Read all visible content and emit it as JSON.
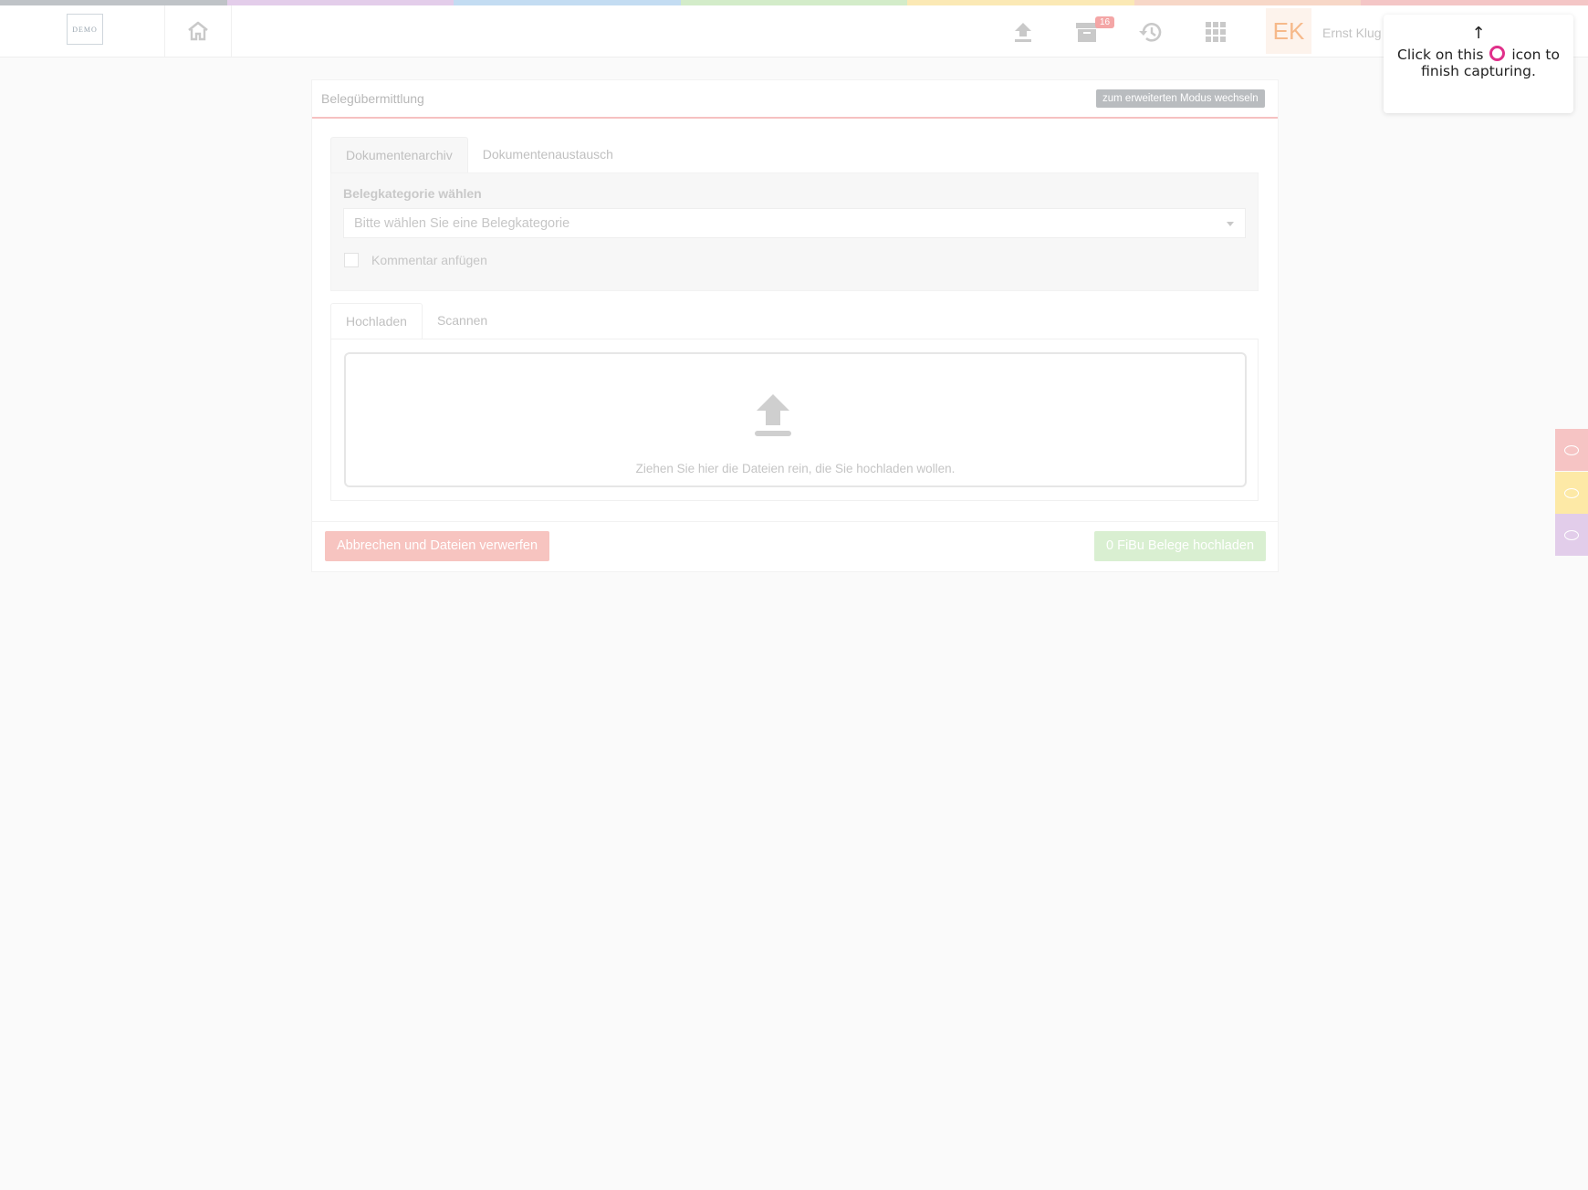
{
  "topstrip_colors": [
    "#bfc3c7",
    "#e3cdea",
    "#c3dcf2",
    "#d3ecc9",
    "#fbe9b5",
    "#f7d7c7",
    "#f4c6c6"
  ],
  "header": {
    "logo_text": "DEMO",
    "home_icon": "home-icon",
    "icons": [
      "upload-icon",
      "archive-icon",
      "history-icon",
      "apps-grid-icon"
    ],
    "archive_badge": "16",
    "avatar_initials": "EK",
    "user_name": "Ernst Klug"
  },
  "tooltip": {
    "arrow": "↑",
    "text_before": "Click on this",
    "text_after": "icon to finish capturing."
  },
  "panel": {
    "title": "Belegübermittlung",
    "mode_button": "zum erweiterten Modus wechseln",
    "tabs": [
      "Dokumentenarchiv",
      "Dokumentenaustausch"
    ],
    "category_label": "Belegkategorie wählen",
    "category_placeholder": "Bitte wählen Sie eine Belegkategorie",
    "comment_label": "Kommentar anfügen",
    "upload_tabs": [
      "Hochladen",
      "Scannen"
    ],
    "dropzone_text": "Ziehen Sie hier die Dateien rein, die Sie hochladen wollen.",
    "cancel_button": "Abbrechen und Dateien verwerfen",
    "upload_button": "0 FiBu Belege hochladen"
  },
  "side_tabs": [
    {
      "color": "#f6c4c4"
    },
    {
      "color": "#fde9a6"
    },
    {
      "color": "#e2cdea"
    }
  ]
}
